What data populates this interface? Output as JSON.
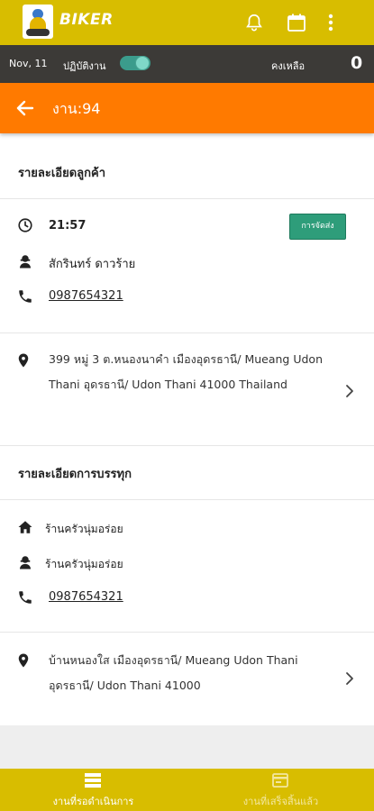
{
  "app": {
    "brand": "BIKER"
  },
  "status": {
    "date": "Nov, 11",
    "work_label": "ปฏิบัติงาน",
    "work_on": true,
    "remaining_label": "คงเหลือ",
    "remaining_count": "0"
  },
  "header": {
    "title": "งาน:94"
  },
  "customer": {
    "section_title": "รายละเอียดลูกค้า",
    "time": "21:57",
    "badge": "การจัดส่ง",
    "name": "สักรินทร์ ดาวร้าย",
    "phone": "0987654321",
    "address": "399 หมู่ 3 ต.หนองนาคำ เมืองอุดรธานี/ Mueang Udon Thani อุดรธานี/ Udon Thani 41000 Thailand"
  },
  "pickup": {
    "section_title": "รายละเอียดการบรรทุก",
    "store": "ร้านครัวนุ่มอร่อย",
    "contact": "ร้านครัวนุ่มอร่อย",
    "phone": "0987654321",
    "address": "บ้านหนองใส เมืองอุดรธานี/ Mueang Udon Thani อุดรธานี/ Udon Thani 41000"
  },
  "bottom_nav": {
    "pending": "งานที่รอดำเนินการ",
    "done": "งานที่เสร็จสิ้นแล้ว"
  },
  "colors": {
    "topbar": "#d8bd00",
    "titlebar": "#ff7a00",
    "badge": "#2e9d7a"
  }
}
